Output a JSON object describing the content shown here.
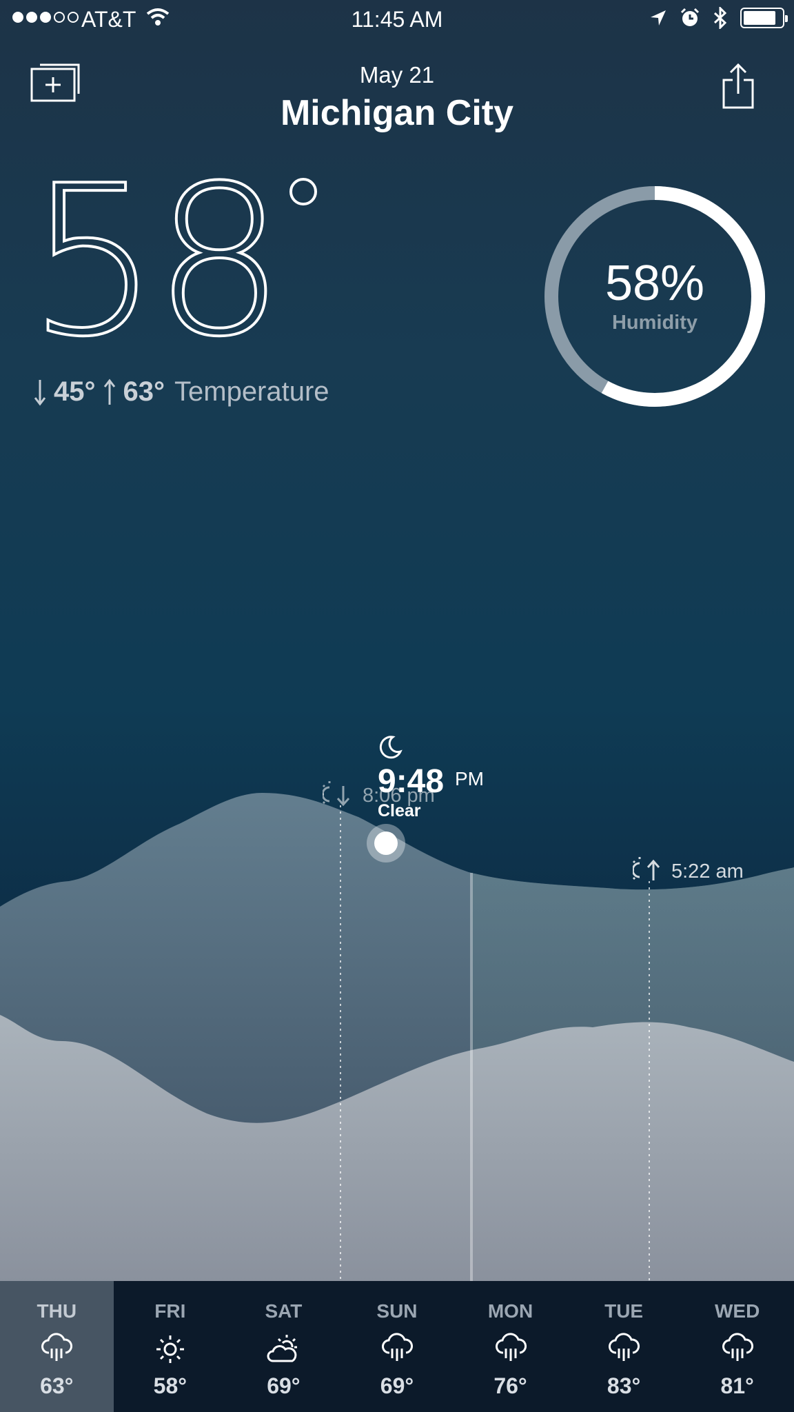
{
  "status_bar": {
    "signal_dots": 5,
    "signal_filled": 3,
    "carrier": "AT&T",
    "time": "11:45 AM",
    "battery_level": 0.85,
    "icons": [
      "wifi-icon",
      "location-arrow-icon",
      "alarm-icon",
      "bluetooth-icon",
      "battery-icon"
    ]
  },
  "header": {
    "date": "May 21",
    "city": "Michigan City",
    "add_icon": "add-location-icon",
    "share_icon": "share-icon"
  },
  "current": {
    "temperature": "58",
    "low": "45°",
    "high": "63°",
    "temperature_label": "Temperature"
  },
  "humidity": {
    "value": "58%",
    "label": "Humidity",
    "fraction": 0.58
  },
  "timeline": {
    "now_time": "9:48",
    "now_ampm": "PM",
    "now_condition": "Clear",
    "now_icon": "moon-icon",
    "sunset": "8:06 pm",
    "sunrise": "5:22 am",
    "sunset_icon": "sunset-icon",
    "sunrise_icon": "sunrise-icon"
  },
  "forecast": [
    {
      "day": "THU",
      "icon": "rain-icon",
      "temp": "63°",
      "active": true
    },
    {
      "day": "FRI",
      "icon": "sun-icon",
      "temp": "58°",
      "active": false
    },
    {
      "day": "SAT",
      "icon": "partly-cloudy-icon",
      "temp": "69°",
      "active": false
    },
    {
      "day": "SUN",
      "icon": "rain-icon",
      "temp": "69°",
      "active": false
    },
    {
      "day": "MON",
      "icon": "rain-icon",
      "temp": "76°",
      "active": false
    },
    {
      "day": "TUE",
      "icon": "rain-icon",
      "temp": "83°",
      "active": false
    },
    {
      "day": "WED",
      "icon": "rain-icon",
      "temp": "81°",
      "active": false
    }
  ],
  "colors": {
    "background_top": "#1d3347",
    "background_mid": "#0f3b54",
    "forecast_bar": "#0c1a2a",
    "active_day": "#475563",
    "humidity_track": "#8a9ba8"
  }
}
